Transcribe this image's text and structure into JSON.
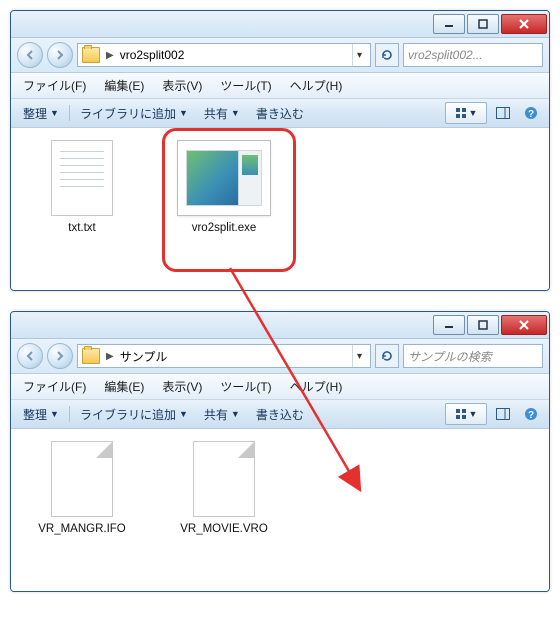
{
  "windows": [
    {
      "address": "vro2split002",
      "search_placeholder": "vro2split002...",
      "menu": {
        "file": "ファイル(F)",
        "edit": "編集(E)",
        "view": "表示(V)",
        "tools": "ツール(T)",
        "help": "ヘルプ(H)"
      },
      "toolbar": {
        "organize": "整理",
        "library": "ライブラリに追加",
        "share": "共有",
        "burn": "書き込む"
      },
      "files": [
        {
          "name": "txt.txt"
        },
        {
          "name": "vro2split.exe"
        }
      ]
    },
    {
      "address": "サンプル",
      "search_placeholder": "サンプルの検索",
      "menu": {
        "file": "ファイル(F)",
        "edit": "編集(E)",
        "view": "表示(V)",
        "tools": "ツール(T)",
        "help": "ヘルプ(H)"
      },
      "toolbar": {
        "organize": "整理",
        "library": "ライブラリに追加",
        "share": "共有",
        "burn": "書き込む"
      },
      "files": [
        {
          "name": "VR_MANGR.IFO"
        },
        {
          "name": "VR_MOVIE.VRO"
        }
      ]
    }
  ]
}
